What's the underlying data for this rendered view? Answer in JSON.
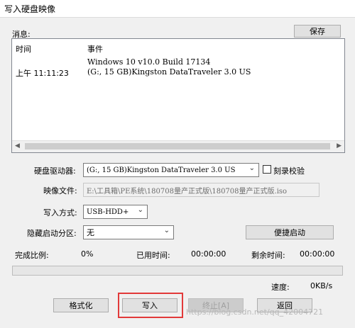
{
  "window": {
    "title": "写入硬盘映像"
  },
  "messages": {
    "label": "消息:",
    "save_label": "保存",
    "columns": {
      "time": "时间",
      "event": "事件"
    },
    "rows": [
      {
        "time": "",
        "event": "Windows 10 v10.0 Build 17134"
      },
      {
        "time": "上午 11:11:23",
        "event": "(G:, 15 GB)Kingston DataTraveler 3.0 US"
      }
    ]
  },
  "form": {
    "disk_drive_label": "硬盘驱动器:",
    "disk_drive_value": "(G:, 15 GB)Kingston DataTraveler 3.0 US",
    "verify_label": "刻录校验",
    "verify_checked": false,
    "image_file_label": "映像文件:",
    "image_file_value": "E:\\工具箱\\PE系统\\180708量产正式版\\180708量产正式版.iso",
    "write_method_label": "写入方式:",
    "write_method_value": "USB-HDD+",
    "hidden_partition_label": "隐藏启动分区:",
    "hidden_partition_value": "无",
    "easy_boot_label": "便捷启动"
  },
  "status": {
    "completion_label": "完成比例:",
    "completion_value": "0%",
    "elapsed_label": "已用时间:",
    "elapsed_value": "00:00:00",
    "remaining_label": "剩余时间:",
    "remaining_value": "00:00:00",
    "progress_fraction": 0,
    "speed_label": "速度:",
    "speed_value": "0KB/s"
  },
  "buttons": {
    "format_label": "格式化",
    "write_label": "写入",
    "abort_label": "终止[A]",
    "back_label": "返回"
  },
  "watermark": "https://blog.csdn.net/qq_42004721",
  "colors": {
    "highlight": "#e23a3a"
  }
}
